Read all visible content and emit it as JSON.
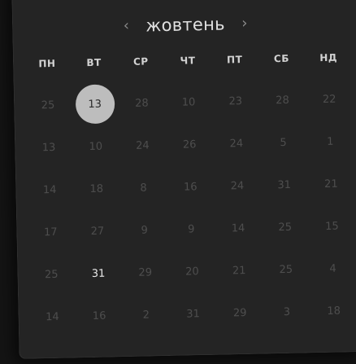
{
  "calendar": {
    "month": "жовтень",
    "prev_icon": "chevron-left-icon",
    "next_icon": "chevron-right-icon",
    "prev_glyph": "‹",
    "next_glyph": "›",
    "weekdays": [
      "ПН",
      "ВТ",
      "СР",
      "ЧТ",
      "ПТ",
      "СБ",
      "НД"
    ],
    "selected_day": "13",
    "today_day": "31",
    "colors": {
      "background": "#242424",
      "selected_circle": "#bdbdbd",
      "weekday_text": "#d2d2d2",
      "day_text": "#4e4e4e"
    },
    "weeks": [
      [
        "25",
        "13",
        "28",
        "10",
        "23",
        "28",
        "22"
      ],
      [
        "13",
        "10",
        "24",
        "26",
        "24",
        "5",
        "1"
      ],
      [
        "14",
        "18",
        "8",
        "16",
        "24",
        "31",
        "21"
      ],
      [
        "17",
        "27",
        "9",
        "9",
        "14",
        "25",
        "15"
      ],
      [
        "25",
        "31",
        "29",
        "20",
        "21",
        "25",
        "4"
      ],
      [
        "14",
        "16",
        "2",
        "31",
        "29",
        "3",
        "18"
      ]
    ]
  }
}
